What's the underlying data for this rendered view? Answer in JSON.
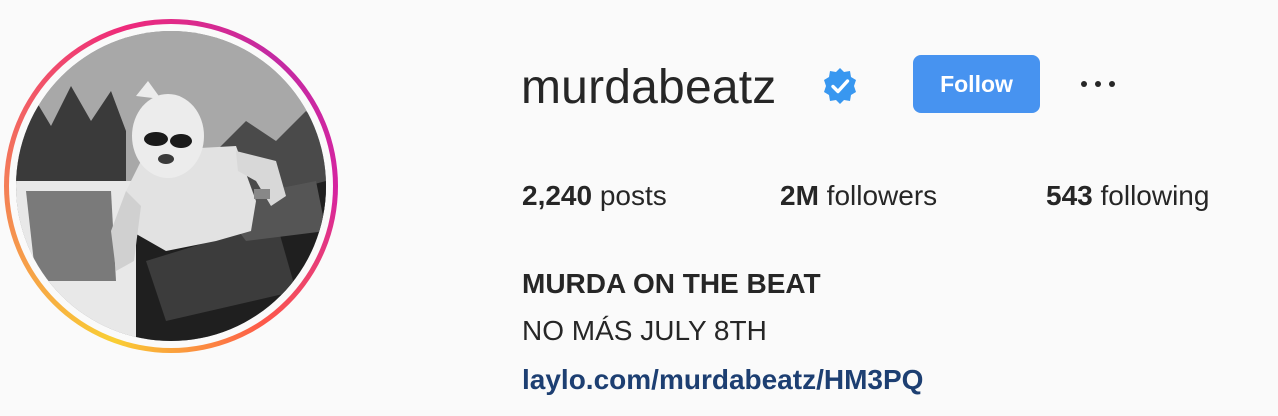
{
  "profile": {
    "username": "murdabeatz",
    "verified": true,
    "follow_label": "Follow",
    "more_label": "More options"
  },
  "stats": {
    "posts_count": "2,240",
    "posts_label": " posts",
    "followers_count": "2M",
    "followers_label": " followers",
    "following_count": "543",
    "following_label": " following"
  },
  "bio": {
    "name": "MURDA ON THE BEAT",
    "text": "NO MÁS JULY 8TH",
    "link": "laylo.com/murdabeatz/HM3PQ"
  },
  "colors": {
    "page_background": "#fafafa",
    "follow_button": "#4793f0",
    "verified_badge": "#3897f0",
    "link": "#1d3f72",
    "text": "#262626"
  },
  "icons": {
    "verified": "verified-badge-icon",
    "more": "more-options-icon"
  }
}
